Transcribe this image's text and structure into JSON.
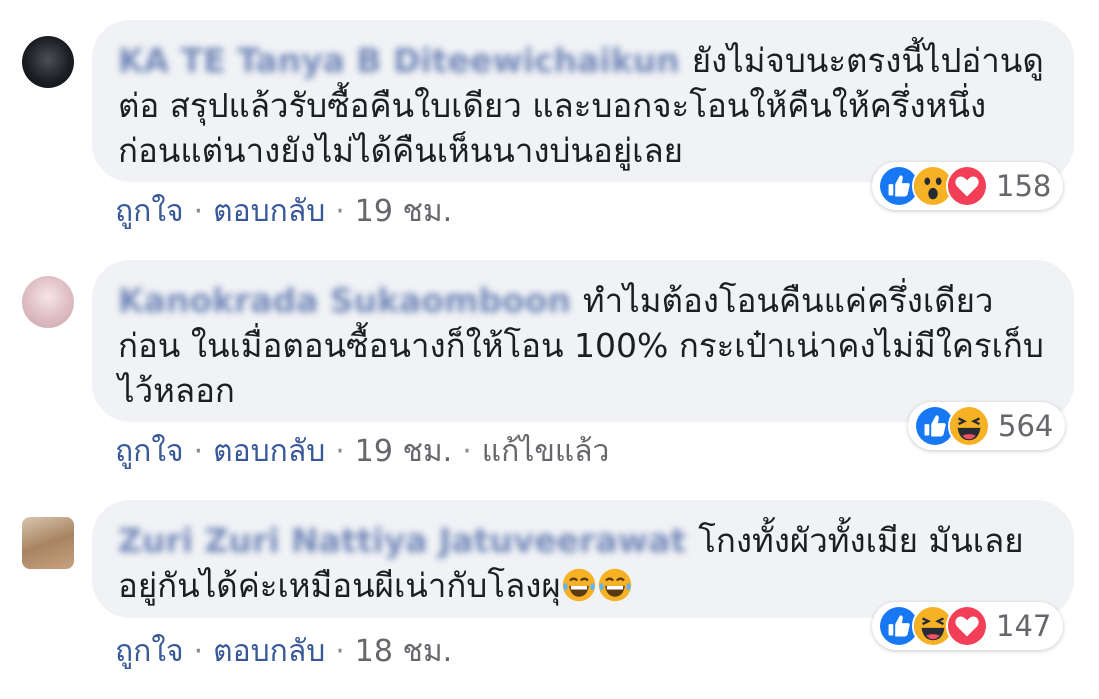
{
  "comments": [
    {
      "author": "KA TE Tanya B Diteewichaikun",
      "text": "ยังไม่จบนะตรงนี้ไปอ่านดูต่อ สรุปแล้วรับซื้อคืนใบเดียว และบอกจะโอนให้คืนให้ครึ่งหนึ่งก่อนแต่นางยังไม่ได้คืนเห็นนางบ่นอยู่เลย",
      "reactions": [
        "like-icon",
        "wow-icon",
        "love-icon"
      ],
      "reaction_count": "158",
      "like_label": "ถูกใจ",
      "reply_label": "ตอบกลับ",
      "time": "19 ชม.",
      "edited": ""
    },
    {
      "author": "Kanokrada Sukaomboon",
      "text": "ทำไมต้องโอนคืนแค่ครึ่งเดียวก่อน ในเมื่อตอนซื้อนางก็ให้โอน 100% กระเป๋าเน่าคงไม่มีใครเก็บไว้หลอก",
      "reactions": [
        "like-icon",
        "haha-icon"
      ],
      "reaction_count": "564",
      "like_label": "ถูกใจ",
      "reply_label": "ตอบกลับ",
      "time": "19 ชม.",
      "edited": "แก้ไขแล้ว"
    },
    {
      "author": "Zuri Zuri Nattiya Jatuveerawat",
      "text": "โกงทั้งผัวทั้งเมีย มันเลยอยู่กันได้ค่ะเหมือนผีเน่ากับโลงผุ",
      "inline_emojis": [
        "laugh-cry-icon",
        "laugh-cry-icon"
      ],
      "reactions": [
        "like-icon",
        "haha-icon",
        "love-icon"
      ],
      "reaction_count": "147",
      "like_label": "ถูกใจ",
      "reply_label": "ตอบกลับ",
      "time": "18 ชม.",
      "edited": ""
    }
  ],
  "colors": {
    "like": "#1877f2",
    "love": "#f33e58",
    "face": "#f7b125",
    "link": "#385898"
  }
}
